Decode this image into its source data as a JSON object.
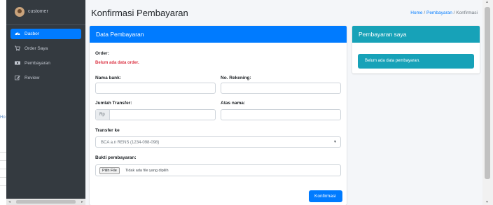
{
  "background_page": {
    "label": "Ho"
  },
  "sidebar": {
    "user_name": "customer",
    "items": [
      {
        "label": "Dasbor",
        "icon": "dashboard-icon",
        "active": true
      },
      {
        "label": "Order Saya",
        "icon": "cart-icon",
        "active": false
      },
      {
        "label": "Pembayaran",
        "icon": "payment-card-icon",
        "active": false
      },
      {
        "label": "Review",
        "icon": "edit-icon",
        "active": false
      }
    ]
  },
  "header": {
    "title": "Konfirmasi Pembayaran",
    "breadcrumb": [
      "Home",
      "Pembayaran",
      "Konfirmasi"
    ],
    "separator": "/"
  },
  "payment_form": {
    "card_title": "Data Pembayaran",
    "order_label": "Order:",
    "order_error": "Belum ada data order.",
    "bank_name_label": "Nama bank:",
    "bank_name_value": "",
    "account_number_label": "No. Rekening:",
    "account_number_value": "",
    "transfer_amount_label": "Jumlah Transfer:",
    "currency_prefix": "Rp",
    "transfer_amount_value": "",
    "account_holder_label": "Atas nama:",
    "account_holder_value": "",
    "transfer_to_label": "Transfer ke",
    "transfer_to_selected": "BCA a.n RENS (1234-098-098)",
    "proof_label": "Bukti pembayaran:",
    "file_button_label": "Pilih File",
    "file_status": "Tidak ada file yang dipilih",
    "submit_label": "Konfirmasi"
  },
  "my_payments": {
    "card_title": "Pembayaran saya",
    "empty_message": "Belum ada data pembayaran."
  },
  "colors": {
    "primary": "#007bff",
    "info": "#17a2b8",
    "danger": "#dc3545",
    "sidebar": "#343a40"
  }
}
